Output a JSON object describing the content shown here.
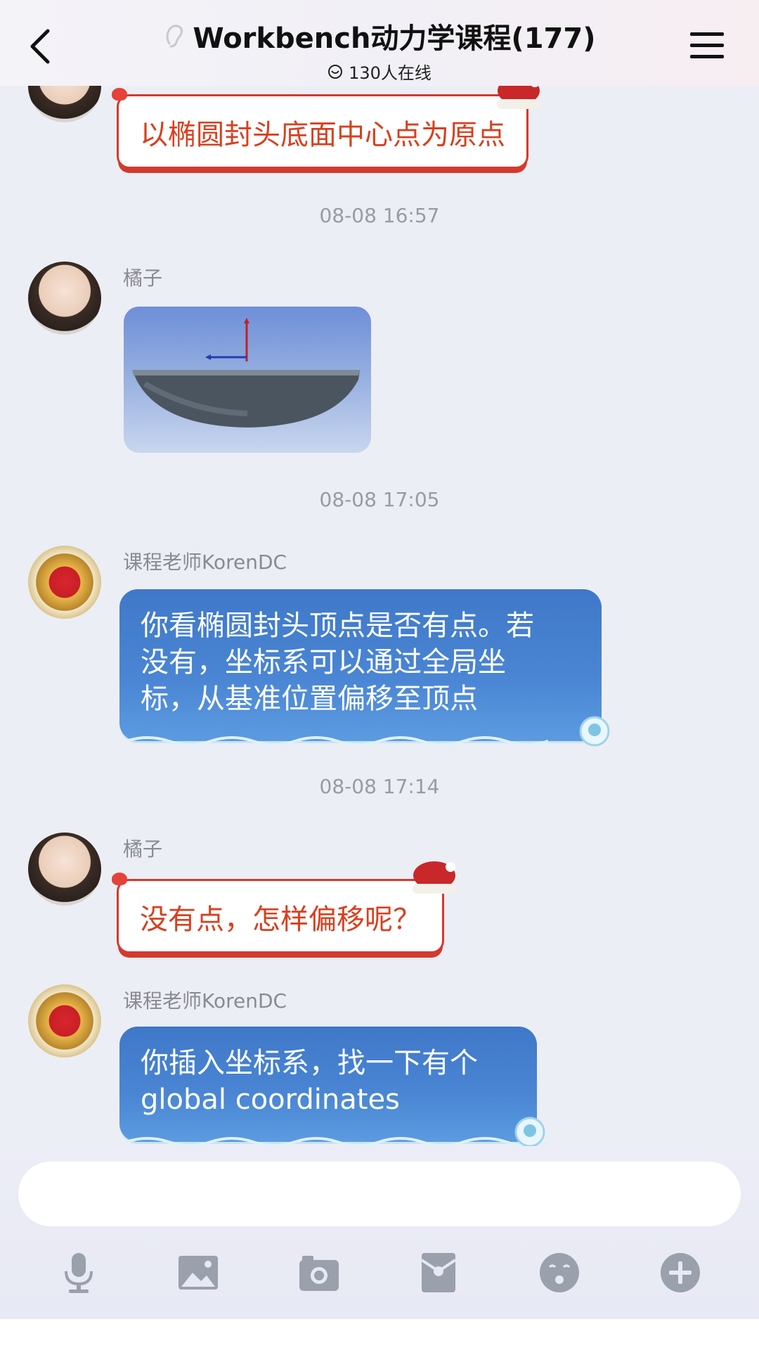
{
  "header": {
    "title": "Workbench动力学课程(177)",
    "online": "130人在线"
  },
  "messages": [
    {
      "type": "text-red",
      "text": "以椭圆封头底面中心点为原点"
    },
    {
      "type": "time",
      "text": "08-08 16:57"
    },
    {
      "type": "image",
      "sender": "橘子"
    },
    {
      "type": "time",
      "text": "08-08 17:05"
    },
    {
      "type": "text-blue",
      "sender": "课程老师KorenDC",
      "lines": [
        "你看椭圆封头顶点是否有点。若",
        "没有，坐标系可以通过全局坐",
        "标，从基准位置偏移至顶点"
      ]
    },
    {
      "type": "time",
      "text": "08-08 17:14"
    },
    {
      "type": "text-red",
      "sender": "橘子",
      "text": "没有点，怎样偏移呢？"
    },
    {
      "type": "text-blue",
      "sender": "课程老师KorenDC",
      "lines": [
        "你插入坐标系，找一下有个",
        "global coordinates"
      ]
    }
  ],
  "input": {
    "placeholder": "",
    "value": ""
  },
  "toolbar": [
    "microphone-icon",
    "image-icon",
    "camera-icon",
    "red-packet-icon",
    "emoji-icon",
    "plus-icon"
  ]
}
